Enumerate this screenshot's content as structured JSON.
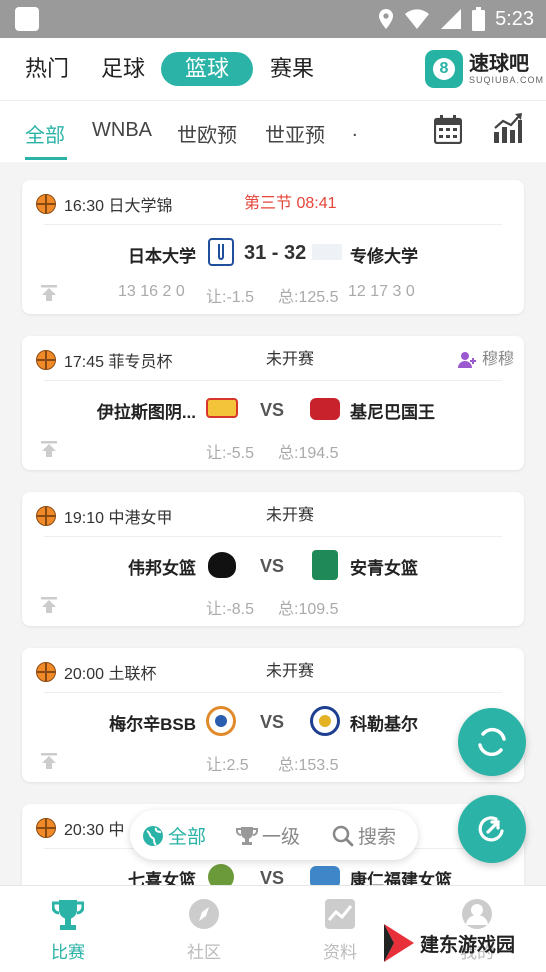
{
  "status_bar": {
    "time": "5:23"
  },
  "top_tabs": [
    {
      "label": "热门"
    },
    {
      "label": "足球"
    },
    {
      "label": "篮球",
      "active": true
    },
    {
      "label": "赛果"
    }
  ],
  "brand": {
    "name": "速球吧",
    "domain": "SUQIUBA.COM",
    "logo_char": "8"
  },
  "sub_tabs": [
    {
      "label": "全部",
      "active": true
    },
    {
      "label": "WNBA"
    },
    {
      "label": "世欧预"
    },
    {
      "label": "世亚预"
    },
    {
      "label": "."
    }
  ],
  "matches": [
    {
      "time_league": "16:30 日大学锦",
      "status": "第三节  08:41",
      "live": true,
      "home": "日本大学",
      "away": "专修大学",
      "score": "31 - 32",
      "home_scores": "13  16  2  0",
      "handicap": "让:-1.5",
      "total": "总:125.5",
      "away_scores": "12  17  3  0"
    },
    {
      "time_league": "17:45 菲专员杯",
      "status": "未开赛",
      "home": "伊拉斯图阴...",
      "away": "基尼巴国王",
      "vs": "VS",
      "handicap": "让:-5.5",
      "total": "总:194.5",
      "follow": "穆穆"
    },
    {
      "time_league": "19:10 中港女甲",
      "status": "未开赛",
      "home": "伟邦女篮",
      "away": "安青女篮",
      "vs": "VS",
      "handicap": "让:-8.5",
      "total": "总:109.5"
    },
    {
      "time_league": "20:00 土联杯",
      "status": "未开赛",
      "home": "梅尔辛BSB",
      "away": "科勒基尔",
      "vs": "VS",
      "handicap": "让:2.5",
      "total": "总:153.5"
    },
    {
      "time_league": "20:30 中",
      "home": "七喜女篮",
      "away": "康仁福建女篮",
      "vs": "VS"
    }
  ],
  "filter_pill": {
    "all": "全部",
    "level1": "一级",
    "search": "搜索"
  },
  "bottom_tabs": [
    {
      "label": "比赛",
      "active": true
    },
    {
      "label": "社区"
    },
    {
      "label": "资料"
    },
    {
      "label": "我的"
    }
  ],
  "watermark": "建东游戏园",
  "colors": {
    "accent": "#2ab3a6",
    "live": "#e5453a"
  }
}
